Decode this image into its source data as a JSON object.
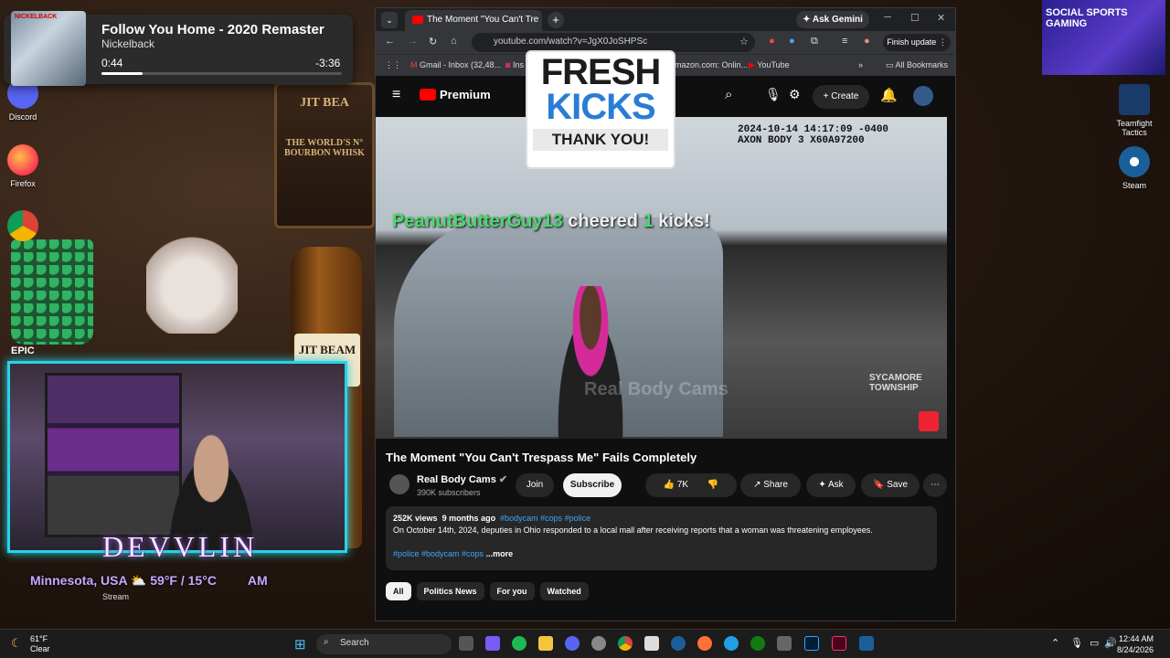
{
  "media_player": {
    "art_text": "NICKELBACK",
    "title": "Follow You Home - 2020 Remaster",
    "artist": "Nickelback",
    "position": "0:44",
    "remaining": "-3:36",
    "progress": 0.17
  },
  "desktop": {
    "icons_left": [
      "Discord",
      "Firefox"
    ],
    "icons_right": [
      "Teamfight Tactics",
      "Steam"
    ],
    "poster_text": "SOCIAL SPORTS GAMING",
    "sign_text": "JIT BEA",
    "sign_sub": "THE WORLD'S N° BOURBON WHISK",
    "bottle_text": "JIT BEAM",
    "webcam_name": "DEVVLIN",
    "weather_line": "Minnesota, USA ⛅ 59°F / 15°C",
    "weather_time": "AM",
    "stream_label": "Stream",
    "epic_label": "EPIC"
  },
  "browser": {
    "tab_title": "The Moment \"You Can't Tre",
    "gemini_label": "Ask Gemini",
    "url": "youtube.com/watch?v=JgX0JoSHPSc",
    "finish_update": "Finish update",
    "bookmarks": [
      "Gmail - Inbox (32,48...",
      "Ins",
      "amazon.com: Onlin...",
      "YouTube"
    ],
    "all_bookmarks": "All Bookmarks"
  },
  "youtube": {
    "logo": "Premium",
    "create_label": "Create",
    "video_timestamp": "2024-10-14 14:17:09 -0400",
    "video_device": "AXON BODY 3 X60A97200",
    "cheer_user": "PeanutButterGuy13",
    "cheer_text_1": "cheered",
    "cheer_count": "1",
    "cheer_text_2": "kicks!",
    "watermark": "Real Body Cams",
    "car_text": "SYCAMORE TOWNSHIP",
    "fresh_line1": "FRESH",
    "fresh_line2": "KICKS",
    "fresh_thanks": "THANK YOU!",
    "title": "The Moment \"You Can't Trespass Me\" Fails Completely",
    "channel": "Real Body Cams",
    "subscribers": "390K subscribers",
    "join": "Join",
    "subscribe": "Subscribe",
    "likes": "7K",
    "share": "Share",
    "ask": "Ask",
    "save": "Save",
    "views": "252K views",
    "age": "9 months ago",
    "tags_top": "#bodycam #cops #police",
    "description": "On October 14th, 2024, deputies in Ohio responded to a local mall after receiving reports that a woman was threatening employees.",
    "tags_bottom": "#police #bodycam #cops",
    "more": "...more",
    "chips": [
      "All",
      "Politics News",
      "For you",
      "Watched"
    ]
  },
  "taskbar": {
    "temp": "61°F",
    "condition": "Clear",
    "search_placeholder": "Search",
    "time": "12:44 AM",
    "date": "8/24/2026"
  },
  "colors": {
    "accent_cyan": "#27d3e8",
    "yt_red": "#ff0000",
    "cheer_green": "#4cd96d",
    "link_blue": "#3ea6ff"
  }
}
